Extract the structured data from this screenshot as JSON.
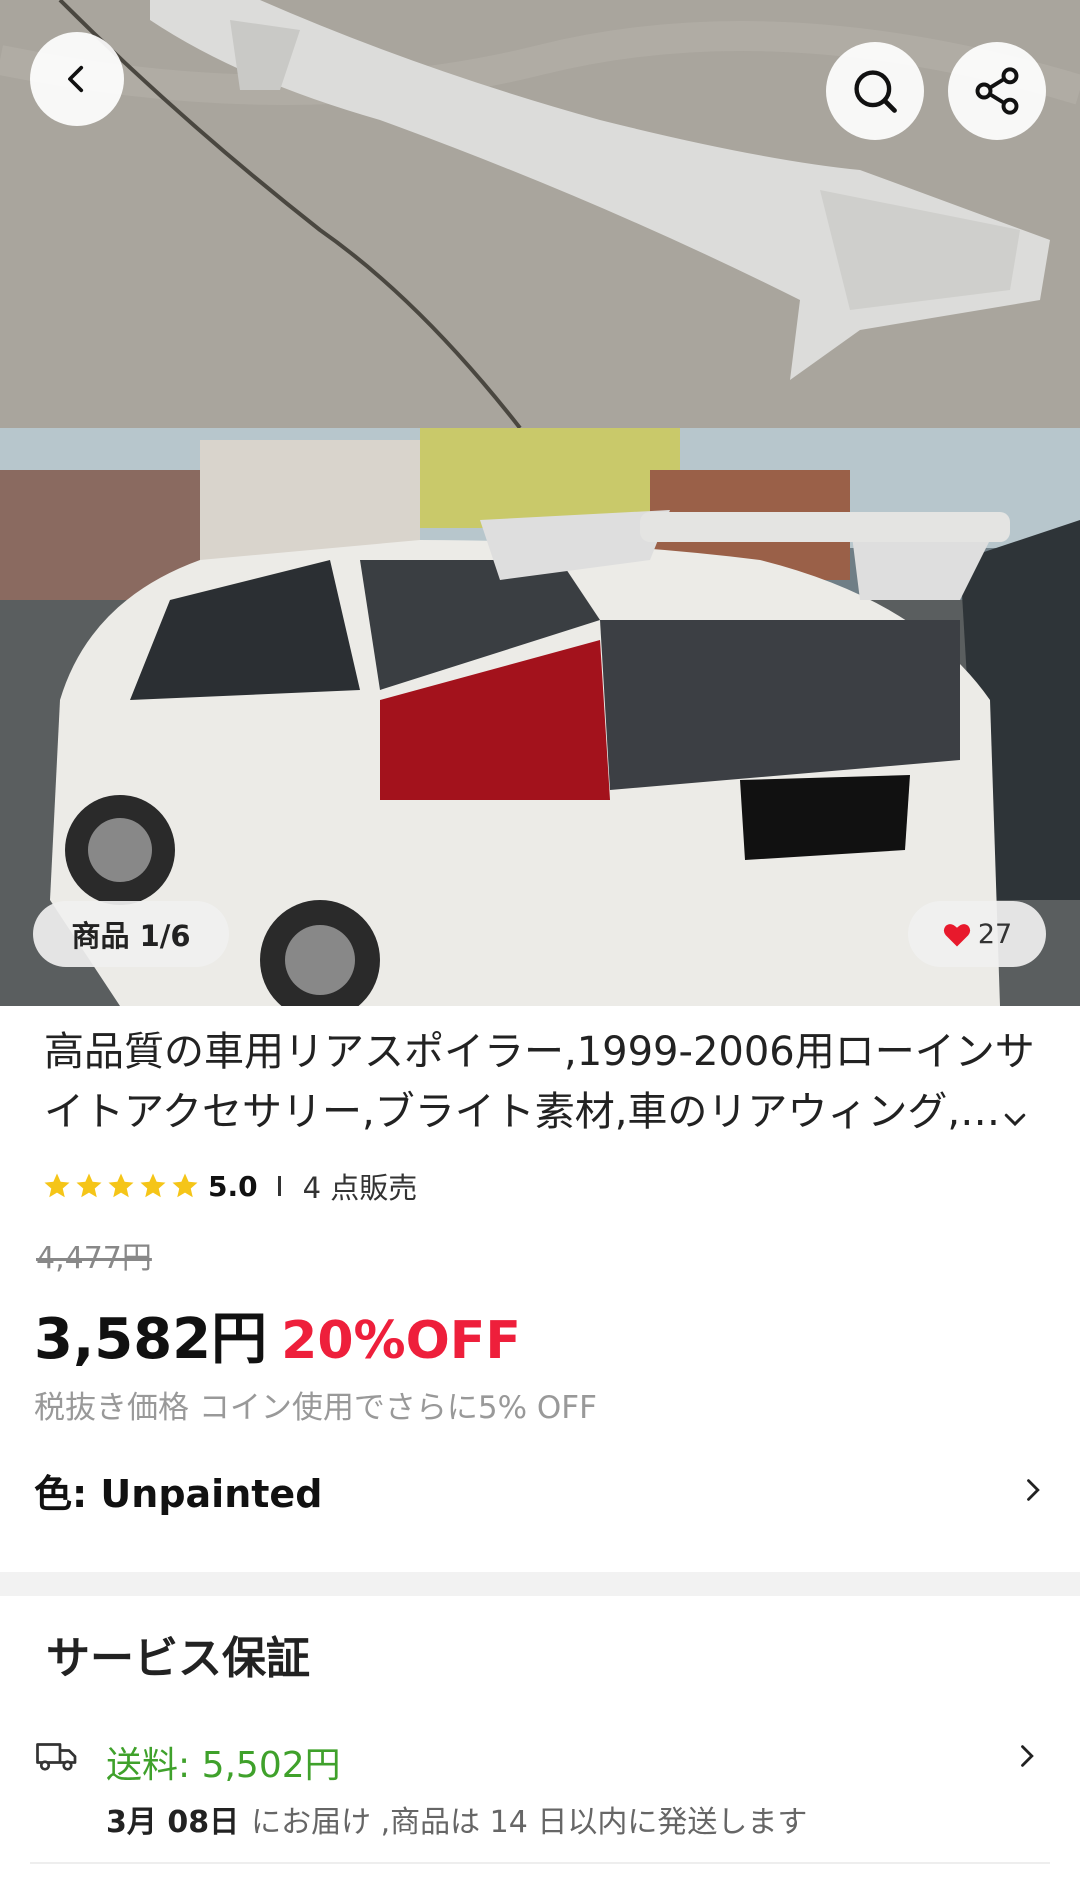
{
  "gallery": {
    "pager_label": "商品 1/6",
    "like_count": "27"
  },
  "product": {
    "title_line1": "高品質の車用リアスポイラー,1999-2006用ローインサ",
    "title_line2": "イトアクセサリー,ブライト素材,車のリアウィング,…",
    "rating": "5.0",
    "star_count": 5,
    "sold": "4 点販売",
    "original_price": "4,477円",
    "price": "3,582円",
    "discount": "20%OFF",
    "tax_note": "税抜き価格 コイン使用でさらに5% OFF",
    "variant": "色: Unpainted"
  },
  "service": {
    "title": "サービス保証",
    "shipping_fee": "送料: 5,502円",
    "delivery_date": "3月 08日",
    "delivery_text": "にお届け ,商品は 14 日以内に発送します"
  },
  "colors": {
    "discount_red": "#ee1f3b",
    "shipping_green": "#3fa12b",
    "star_yellow": "#f5c518",
    "heart_red": "#e8192c"
  },
  "icons": [
    "back-arrow-icon",
    "search-icon",
    "share-icon",
    "heart-icon",
    "star-icon",
    "chevron-down-icon",
    "chevron-right-icon",
    "truck-icon"
  ]
}
